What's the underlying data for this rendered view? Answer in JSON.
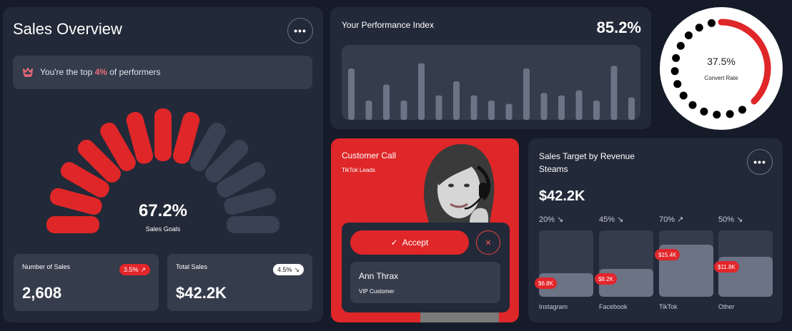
{
  "sales_overview": {
    "title": "Sales Overview",
    "banner": {
      "prefix": "You're the top ",
      "highlight": "4%",
      "suffix": " of performers"
    },
    "gauge": {
      "value": "67.2%",
      "label": "Sales Goals",
      "segments_total": 13,
      "segments_active": 8
    },
    "number_of_sales": {
      "label": "Number of Sales",
      "value": "2,608",
      "change": "3.5%"
    },
    "total_sales": {
      "label": "Total Sales",
      "value": "$42.2K",
      "change": "4.5%"
    }
  },
  "performance_index": {
    "title": "Your Performance Index",
    "value": "85.2%",
    "bars": [
      80,
      30,
      55,
      30,
      88,
      38,
      60,
      38,
      30,
      25,
      80,
      42,
      38,
      46,
      30,
      84,
      35
    ]
  },
  "convert_rate": {
    "value": "37.5%",
    "label": "Convert Rate",
    "fraction": 0.375
  },
  "customer_call": {
    "title": "Customer Call",
    "subtitle": "TikTok Leads",
    "accept_label": "Accept",
    "contact_name": "Ann Thrax",
    "contact_role": "VIP Customer"
  },
  "sales_target": {
    "title": "Sales Target by Revenue Steams",
    "value": "$42.2K",
    "channels": [
      {
        "name": "Instagram",
        "pct": "20%",
        "direction": "down",
        "amount": "$6.8K",
        "level": 0.35
      },
      {
        "name": "Facebook",
        "pct": "45%",
        "direction": "down",
        "amount": "$8.2K",
        "level": 0.42
      },
      {
        "name": "TikTok",
        "pct": "70%",
        "direction": "up",
        "amount": "$15.4K",
        "level": 0.78
      },
      {
        "name": "Other",
        "pct": "50%",
        "direction": "down",
        "amount": "$11.8K",
        "level": 0.6
      }
    ]
  },
  "colors": {
    "accent": "#df2628",
    "card": "#222938",
    "inner": "#353c4c",
    "background": "#151b29",
    "muted_bar": "#6b7385"
  }
}
